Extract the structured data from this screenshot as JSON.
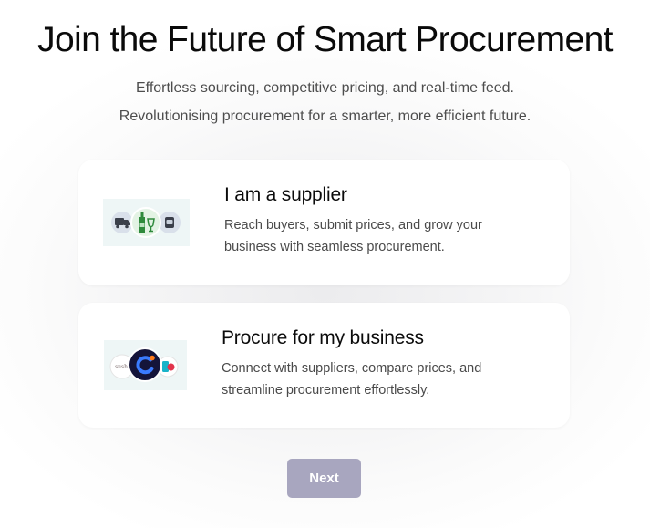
{
  "header": {
    "title": "Join the Future of Smart Procurement",
    "subtitle_line1": "Effortless sourcing, competitive pricing, and real-time feed.",
    "subtitle_line2": "Revolutionising procurement for a smarter, more efficient future."
  },
  "options": [
    {
      "title": "I am a supplier",
      "description": "Reach buyers, submit prices, and grow your business with seamless procurement.",
      "icons": [
        "delivery-truck-icon",
        "bottle-icon",
        "wine-glass-icon",
        "food-can-icon"
      ]
    },
    {
      "title": "Procure for my business",
      "description": "Connect with suppliers, compare prices, and streamline procurement effortlessly.",
      "logos": [
        "restaurant-logo-left",
        "business-logo-center",
        "brand-logo-right"
      ],
      "logo_text_left": "sushi"
    }
  ],
  "actions": {
    "next_label": "Next"
  },
  "colors": {
    "next_button": "#a8a6bf",
    "title": "#0a0a0a",
    "subtitle": "#4d4d4d",
    "card_background": "#ffffff",
    "illustration_background": "#eef6f6"
  }
}
